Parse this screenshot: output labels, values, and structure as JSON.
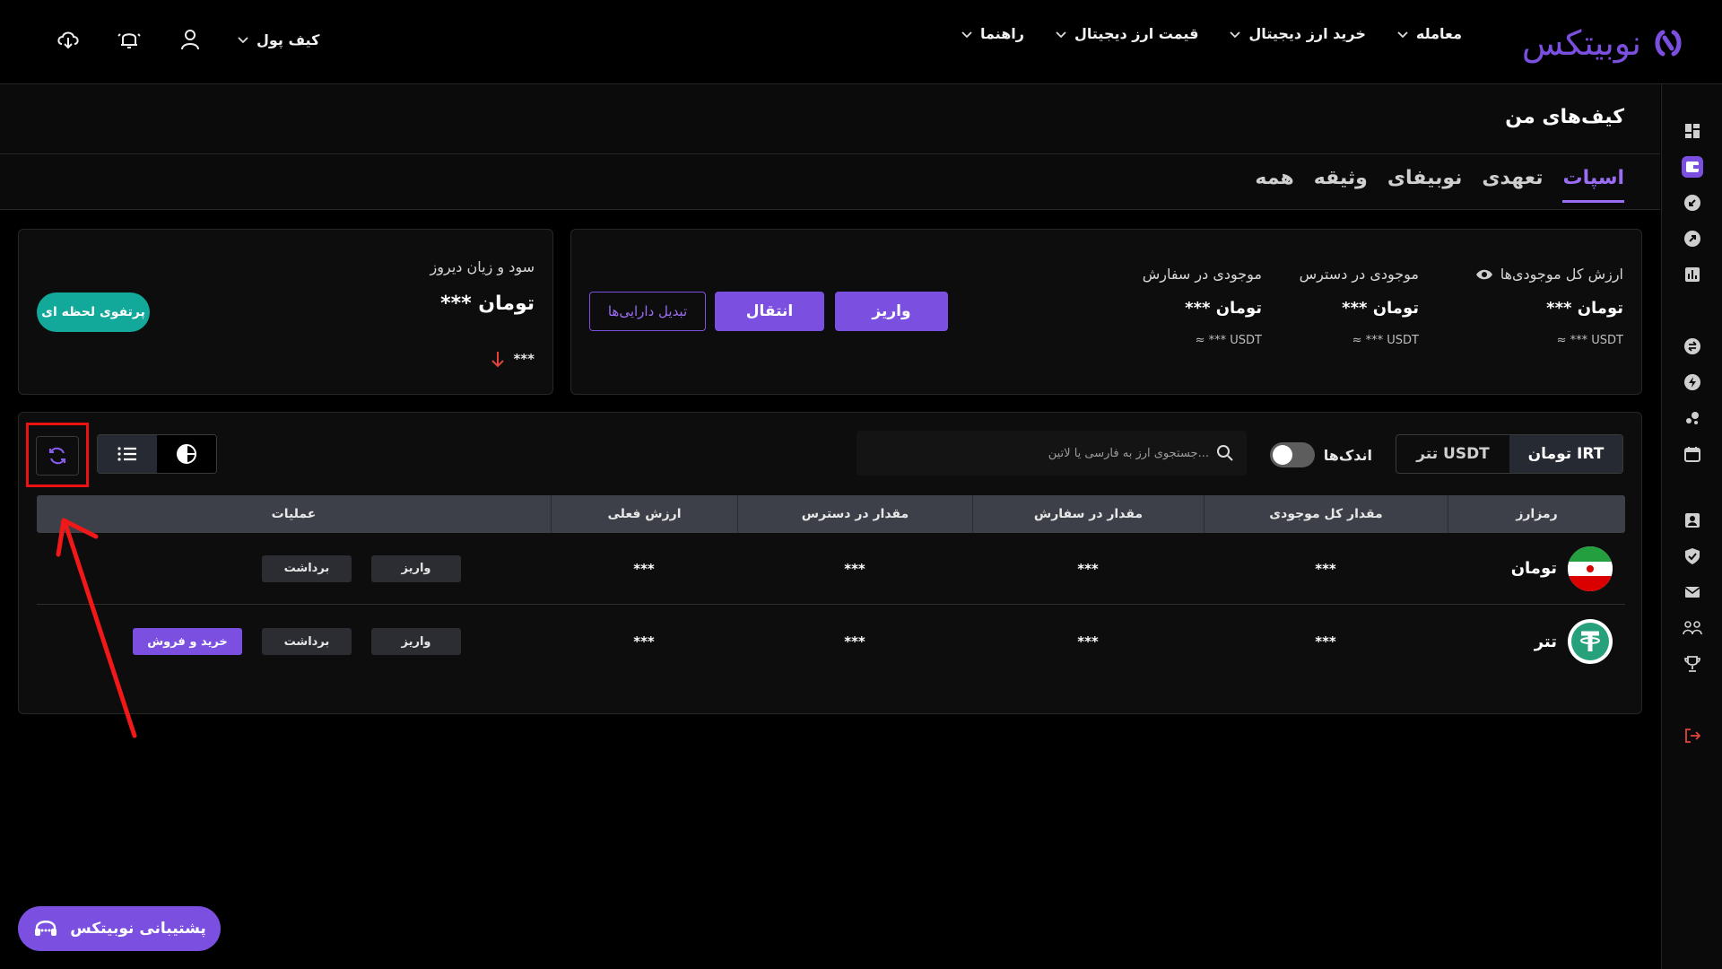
{
  "brand": {
    "logo_text": "نوبیتکس",
    "accent": "#7b4fe0"
  },
  "nav": [
    {
      "label": "معامله"
    },
    {
      "label": "خرید ارز دیجیتال"
    },
    {
      "label": "قیمت ارز دیجیتال"
    },
    {
      "label": "راهنما"
    }
  ],
  "header": {
    "wallet_label": "کیف پول"
  },
  "page": {
    "title": "کیف‌های من",
    "tabs": [
      {
        "label": "اسپات",
        "active": true
      },
      {
        "label": "تعهدی"
      },
      {
        "label": "نوبیفای"
      },
      {
        "label": "وثیقه"
      },
      {
        "label": "همه"
      }
    ]
  },
  "summary": {
    "total": {
      "label": "ارزش کل موجودی‌ها",
      "value": "*** تومان",
      "sub": "≈ *** USDT"
    },
    "available": {
      "label": "موجودی در دسترس",
      "value": "*** تومان",
      "sub": "≈ *** USDT"
    },
    "in_order": {
      "label": "موجودی در سفارش",
      "value": "*** تومان",
      "sub": "≈ *** USDT"
    },
    "deposit_label": "واریز",
    "transfer_label": "انتقال",
    "convert_label": "تبدیل دارایی‌ها"
  },
  "pnl": {
    "title": "سود و زیان دیروز",
    "value": "*** تومان",
    "change": "***",
    "portfolio_button": "پرتفوی لحظه ای"
  },
  "assets": {
    "currency_options": [
      {
        "label": "تومان IRT",
        "active": true
      },
      {
        "label": "تتر USDT"
      }
    ],
    "small_balances_label": "اندک‌ها",
    "search_placeholder": "جستجوی ارز به فارسی یا لاتین...",
    "columns": [
      "رمزارز",
      "مقدار کل موجودی",
      "مقدار در سفارش",
      "مقدار در دسترس",
      "ارزش فعلی",
      "عملیات"
    ],
    "rows": [
      {
        "asset": "تومان",
        "total": "***",
        "in_order": "***",
        "available": "***",
        "value": "***",
        "deposit": "واریز",
        "withdraw": "برداشت"
      },
      {
        "asset": "تتر",
        "total": "***",
        "in_order": "***",
        "available": "***",
        "value": "***",
        "deposit": "واریز",
        "withdraw": "برداشت",
        "trade": "خرید و فروش"
      }
    ]
  },
  "support": {
    "label": "پشتیبانی نوبیتکس"
  }
}
